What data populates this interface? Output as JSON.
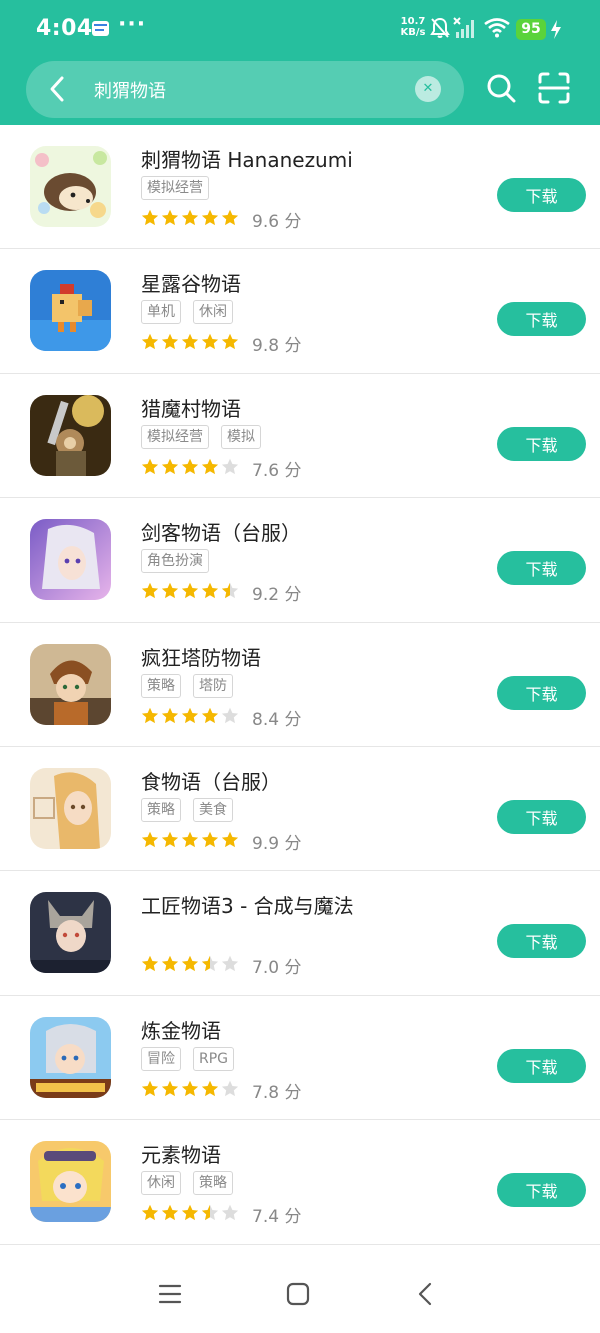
{
  "status_bar": {
    "time": "4:04",
    "more": "···",
    "speed_value": "10.7",
    "speed_unit": "KB/s",
    "battery": "95",
    "icons": [
      "notification-icon",
      "mute-icon",
      "signal-off-icon",
      "wifi-icon",
      "charging-icon"
    ]
  },
  "search": {
    "query": "刺猬物语",
    "icons": [
      "back-icon",
      "clear-icon",
      "search-icon",
      "scan-icon"
    ]
  },
  "colors": {
    "accent": "#26bf9e",
    "star": "#f5b800",
    "star_empty": "#dddddd",
    "battery": "#5ad33b"
  },
  "apps": [
    {
      "name": "刺猬物语 Hananezumi",
      "tags": [
        "模拟经营"
      ],
      "rating": 5,
      "score": "9.6 分",
      "button": "下载"
    },
    {
      "name": "星露谷物语",
      "tags": [
        "单机",
        "休闲"
      ],
      "rating": 5,
      "score": "9.8 分",
      "button": "下载"
    },
    {
      "name": "猎魔村物语",
      "tags": [
        "模拟经营",
        "模拟"
      ],
      "rating": 4,
      "score": "7.6 分",
      "button": "下载"
    },
    {
      "name": "剑客物语（台服）",
      "tags": [
        "角色扮演"
      ],
      "rating": 4.5,
      "score": "9.2 分",
      "button": "下载"
    },
    {
      "name": "疯狂塔防物语",
      "tags": [
        "策略",
        "塔防"
      ],
      "rating": 4,
      "score": "8.4 分",
      "button": "下载"
    },
    {
      "name": "食物语（台服）",
      "tags": [
        "策略",
        "美食"
      ],
      "rating": 5,
      "score": "9.9 分",
      "button": "下载"
    },
    {
      "name": "工匠物语3 - 合成与魔法",
      "tags": [],
      "rating": 3.5,
      "score": "7.0 分",
      "button": "下载"
    },
    {
      "name": "炼金物语",
      "tags": [
        "冒险",
        "RPG"
      ],
      "rating": 4,
      "score": "7.8 分",
      "button": "下载"
    },
    {
      "name": "元素物语",
      "tags": [
        "休闲",
        "策略"
      ],
      "rating": 3.5,
      "score": "7.4 分",
      "button": "下载"
    }
  ],
  "nav": {
    "icons": [
      "menu-icon",
      "home-icon",
      "back-icon"
    ]
  }
}
